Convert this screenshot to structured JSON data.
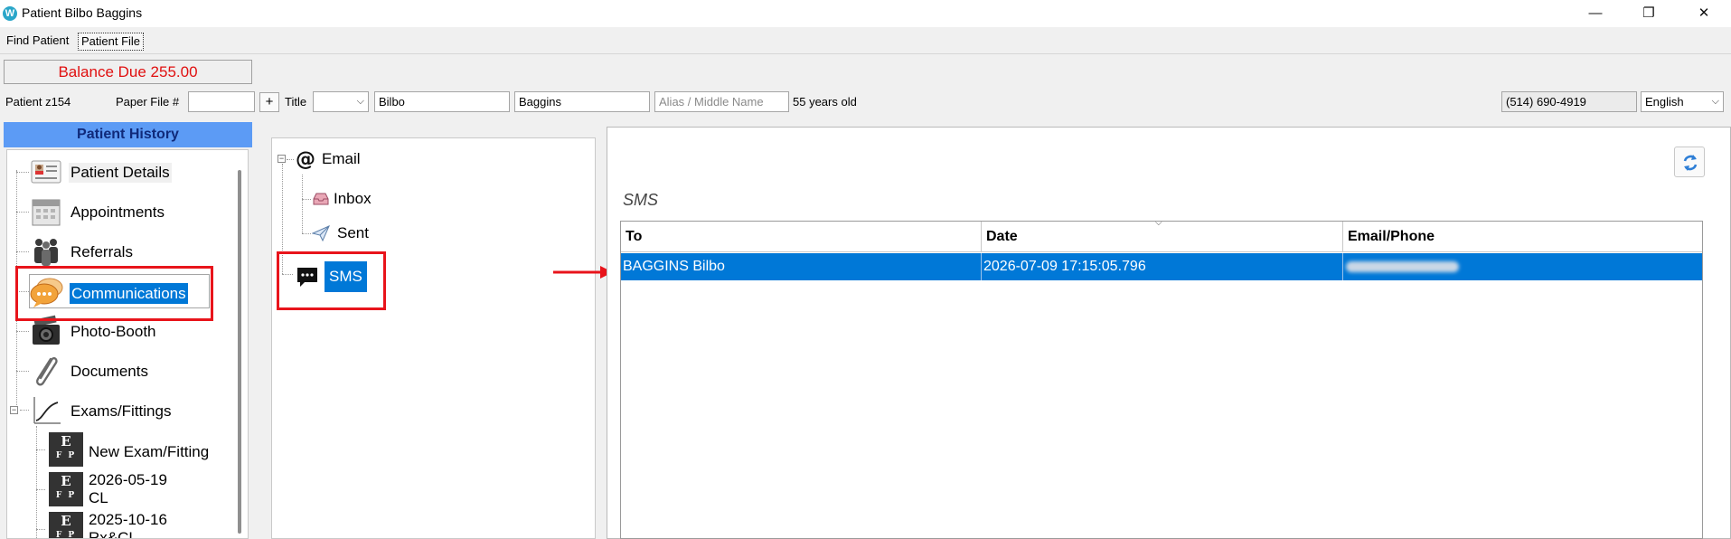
{
  "window": {
    "title": "Patient Bilbo Baggins",
    "app_icon_letter": "W",
    "controls": {
      "minimize": "—",
      "maximize": "❐",
      "close": "✕"
    }
  },
  "tabs": [
    {
      "label": "Find Patient"
    },
    {
      "label": "Patient File"
    }
  ],
  "balance": {
    "label": "Balance Due 255.00"
  },
  "patient_bar": {
    "patient_id": "Patient z154",
    "paper_file_label": "Paper File #",
    "paper_file_value": "",
    "add_label": "+",
    "title_label": "Title",
    "title_value": "",
    "first_name": "Bilbo",
    "last_name": "Baggins",
    "alias_placeholder": "Alias / Middle Name",
    "age_text": "55 years old",
    "phone": "(514) 690-4919",
    "language": "English"
  },
  "patient_history": {
    "header": "Patient History",
    "items": [
      {
        "label": "Patient Details",
        "icon": "id-card-icon"
      },
      {
        "label": "Appointments",
        "icon": "calendar-icon"
      },
      {
        "label": "Referrals",
        "icon": "people-icon"
      },
      {
        "label": "Communications",
        "icon": "speech-bubbles-icon",
        "selected": true
      },
      {
        "label": "Photo-Booth",
        "icon": "camera-icon"
      },
      {
        "label": "Documents",
        "icon": "paperclip-icon"
      },
      {
        "label": "Exams/Fittings",
        "icon": "graph-icon"
      }
    ],
    "exam_children": [
      {
        "line1": "New Exam/Fitting",
        "line2": ""
      },
      {
        "line1": "2026-05-19",
        "line2": "CL"
      },
      {
        "line1": "2025-10-16",
        "line2": "Rx&CL"
      }
    ],
    "efp_top": "E",
    "efp_bottom": "F P"
  },
  "communications_tree": {
    "email_label": "Email",
    "inbox_label": "Inbox",
    "sent_label": "Sent",
    "sms_label": "SMS"
  },
  "sms_panel": {
    "title": "SMS",
    "columns": [
      "To",
      "Date",
      "Email/Phone"
    ],
    "rows": [
      {
        "to": "BAGGINS Bilbo",
        "date": "2026-07-09 17:15:05.796",
        "email_phone": ""
      }
    ]
  },
  "colors": {
    "selection": "#0078d7",
    "highlight_box": "#e8141b",
    "balance_text": "#e01010",
    "history_header": "#5c9bf5"
  }
}
